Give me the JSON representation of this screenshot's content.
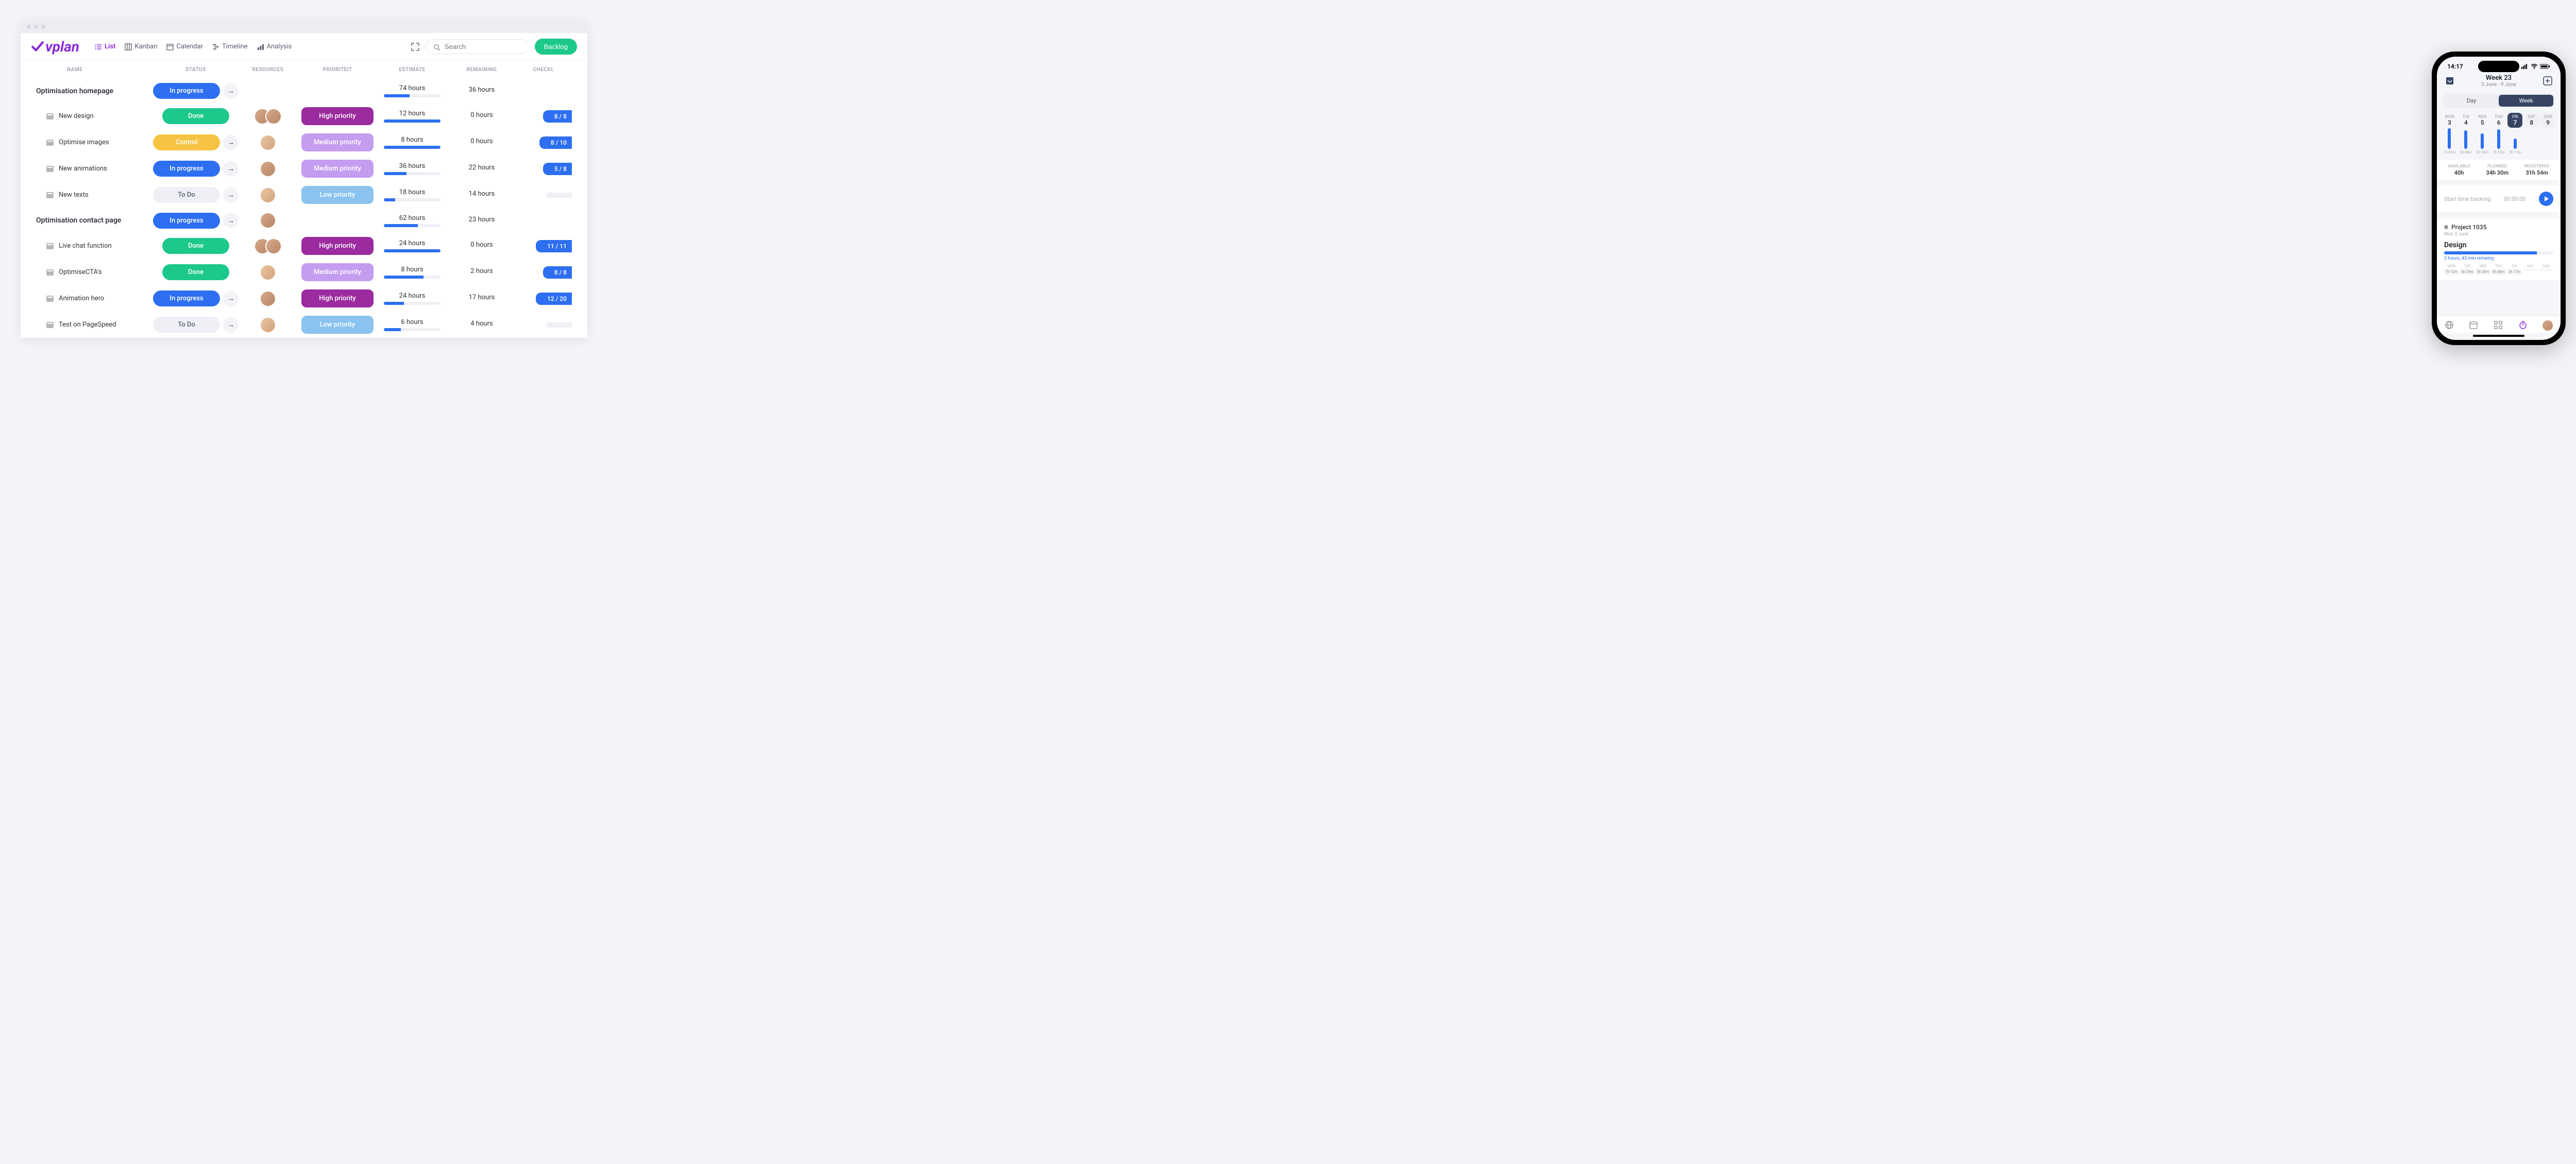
{
  "brand": "vplan",
  "nav": {
    "tabs": [
      {
        "label": "List",
        "icon": "list",
        "active": true
      },
      {
        "label": "Kanban",
        "icon": "kanban"
      },
      {
        "label": "Calendar",
        "icon": "calendar"
      },
      {
        "label": "Timeline",
        "icon": "timeline"
      },
      {
        "label": "Analysis",
        "icon": "analysis"
      }
    ],
    "search_placeholder": "Search",
    "backlog_label": "Backlog"
  },
  "columns": {
    "name": "NAME",
    "status": "STATUS",
    "resources": "RESOURCES",
    "priority": "PRIORITEIT",
    "estimate": "ESTIMATE",
    "remaining": "REMAINING",
    "checklist": "CHECKL"
  },
  "rows": [
    {
      "type": "parent",
      "name": "Optimisation homepage",
      "status": "In progress",
      "status_class": "inprogress",
      "arrow": true,
      "resources": [],
      "priority": null,
      "estimate": "74 hours",
      "est_pct": 45,
      "remaining": "36 hours",
      "checklist": null
    },
    {
      "type": "sub",
      "name": "New design",
      "status": "Done",
      "status_class": "done",
      "arrow": false,
      "resources": [
        "m",
        "m"
      ],
      "priority": "High priority",
      "prio_class": "high",
      "estimate": "12 hours",
      "est_pct": 100,
      "remaining": "0 hours",
      "checklist": "8 / 8"
    },
    {
      "type": "sub",
      "name": "Optimise images",
      "status": "Control",
      "status_class": "control",
      "arrow": true,
      "resources": [
        "f"
      ],
      "priority": "Medium priority",
      "prio_class": "medium",
      "estimate": "8 hours",
      "est_pct": 100,
      "remaining": "0 hours",
      "checklist": "8 / 10"
    },
    {
      "type": "sub",
      "name": "New animations",
      "status": "In progress",
      "status_class": "inprogress",
      "arrow": true,
      "resources": [
        "m"
      ],
      "priority": "Medium priority",
      "prio_class": "medium",
      "estimate": "36 hours",
      "est_pct": 40,
      "remaining": "22 hours",
      "checklist": "5 / 8"
    },
    {
      "type": "sub",
      "name": "New texts",
      "status": "To Do",
      "status_class": "todo",
      "arrow": true,
      "resources": [
        "f"
      ],
      "priority": "Low priority",
      "prio_class": "low",
      "estimate": "18 hours",
      "est_pct": 20,
      "remaining": "14 hours",
      "checklist": ""
    },
    {
      "type": "parent",
      "name": "Optimisation contact page",
      "status": "In progress",
      "status_class": "inprogress",
      "arrow": true,
      "resources": [
        "m"
      ],
      "priority": null,
      "estimate": "62 hours",
      "est_pct": 60,
      "remaining": "23 hours",
      "checklist": null
    },
    {
      "type": "sub",
      "name": "Live chat function",
      "status": "Done",
      "status_class": "done",
      "arrow": false,
      "resources": [
        "m",
        "m"
      ],
      "priority": "High priority",
      "prio_class": "high",
      "estimate": "24 hours",
      "est_pct": 100,
      "remaining": "0 hours",
      "checklist": "11 / 11"
    },
    {
      "type": "sub",
      "name": "OptimiseCTA's",
      "status": "Done",
      "status_class": "done",
      "arrow": false,
      "resources": [
        "f"
      ],
      "priority": "Medium priority",
      "prio_class": "medium",
      "estimate": "8 hours",
      "est_pct": 70,
      "remaining": "2 hours",
      "checklist": "8 / 8"
    },
    {
      "type": "sub",
      "name": "Animation hero",
      "status": "In progress",
      "status_class": "inprogress",
      "arrow": true,
      "resources": [
        "m"
      ],
      "priority": "High priority",
      "prio_class": "high",
      "estimate": "24 hours",
      "est_pct": 35,
      "remaining": "17 hours",
      "checklist": "12 / 20"
    },
    {
      "type": "sub",
      "name": "Test on PageSpeed",
      "status": "To Do",
      "status_class": "todo",
      "arrow": true,
      "resources": [
        "f"
      ],
      "priority": "Low priority",
      "prio_class": "low",
      "estimate": "6 hours",
      "est_pct": 30,
      "remaining": "4 hours",
      "checklist": ""
    }
  ],
  "phone": {
    "time": "14:17",
    "week_title": "Week 23",
    "week_range": "3 June - 9 June",
    "seg": {
      "day": "Day",
      "week": "Week"
    },
    "days": [
      {
        "dow": "MON",
        "num": "3"
      },
      {
        "dow": "TUE",
        "num": "4"
      },
      {
        "dow": "WED",
        "num": "5"
      },
      {
        "dow": "THU",
        "num": "6"
      },
      {
        "dow": "FRI",
        "num": "7",
        "active": true
      },
      {
        "dow": "SAT",
        "num": "8",
        "weekend": true
      },
      {
        "dow": "SUN",
        "num": "9",
        "weekend": true
      }
    ],
    "bars": [
      {
        "h": 40,
        "label": "7h 42m"
      },
      {
        "h": 36,
        "label": "6h 48m"
      },
      {
        "h": 30,
        "label": "5h 36m"
      },
      {
        "h": 38,
        "label": "7h 12m"
      },
      {
        "h": 20,
        "label": "3h 17m"
      },
      {
        "h": 0,
        "label": ""
      },
      {
        "h": 0,
        "label": ""
      }
    ],
    "summary": {
      "available_l": "AVAILABLE",
      "available_v": "40h",
      "planned_l": "PLANNED",
      "planned_v": "34h 30m",
      "registered_l": "REGISTERED",
      "registered_v": "31h 54m"
    },
    "track_label": "Start time tracking",
    "track_time": "00:00:00",
    "project_title": "Project 1035",
    "project_date": "Mon 3 June",
    "task_title": "Design",
    "remain": "2 hours, 43 min remaing",
    "mini_days": [
      {
        "dow": "MON",
        "val": "7h 12m"
      },
      {
        "dow": "TUE",
        "val": "6h 24m"
      },
      {
        "dow": "WED",
        "val": "5h 36m"
      },
      {
        "dow": "THU",
        "val": "6h 48m"
      },
      {
        "dow": "FRI",
        "val": "3h 17m"
      },
      {
        "dow": "SAT",
        "val": ""
      },
      {
        "dow": "SUN",
        "val": ""
      }
    ]
  }
}
